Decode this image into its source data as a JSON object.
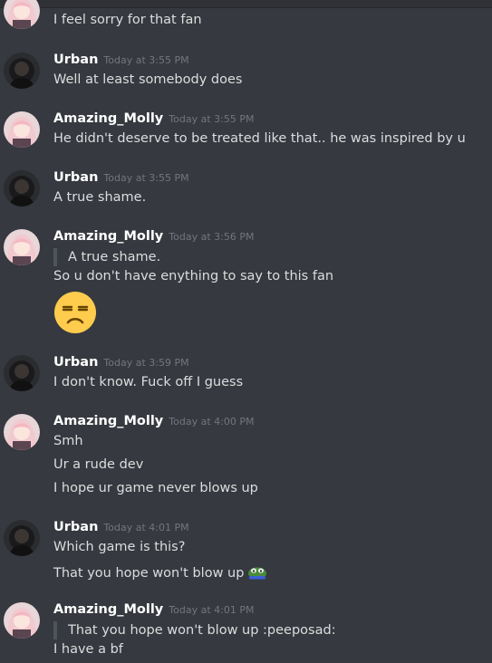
{
  "messages": [
    {
      "lines": [
        "I feel sorry for that fan"
      ]
    },
    {
      "author": "Urban",
      "timestamp": "Today at 3:55 PM",
      "lines": [
        "Well at least somebody does"
      ]
    },
    {
      "author": "Amazing_Molly",
      "timestamp": "Today at 3:55 PM",
      "lines": [
        "He didn't deserve to be treated like that.. he was inspired by u"
      ]
    },
    {
      "author": "Urban",
      "timestamp": "Today at 3:55 PM",
      "lines": [
        "A true shame."
      ]
    },
    {
      "author": "Amazing_Molly",
      "timestamp": "Today at 3:56 PM",
      "quote": "A true shame.",
      "lines": [
        "So u don't have enything to say to this fan"
      ],
      "emoji": "unamused-face-emoji"
    },
    {
      "author": "Urban",
      "timestamp": "Today at 3:59 PM",
      "lines": [
        "I don't know. Fuck off I guess"
      ]
    },
    {
      "author": "Amazing_Molly",
      "timestamp": "Today at 4:00 PM",
      "lines": [
        "Smh",
        "Ur a rude dev",
        "I hope ur game never blows up"
      ]
    },
    {
      "author": "Urban",
      "timestamp": "Today at 4:01 PM",
      "lines": [
        "Which game is this?",
        "That you hope won't blow up"
      ],
      "inline_emoji": "peeposad-emoji"
    },
    {
      "author": "Amazing_Molly",
      "timestamp": "Today at 4:01 PM",
      "quote": "That you hope won't blow up :peeposad:",
      "lines": [
        "I have a bf"
      ]
    }
  ],
  "colors": {
    "background": "#36393f",
    "author": "#ffffff",
    "text": "#dcddde",
    "timestamp": "#72767d",
    "quote_bar": "#4f545c"
  }
}
